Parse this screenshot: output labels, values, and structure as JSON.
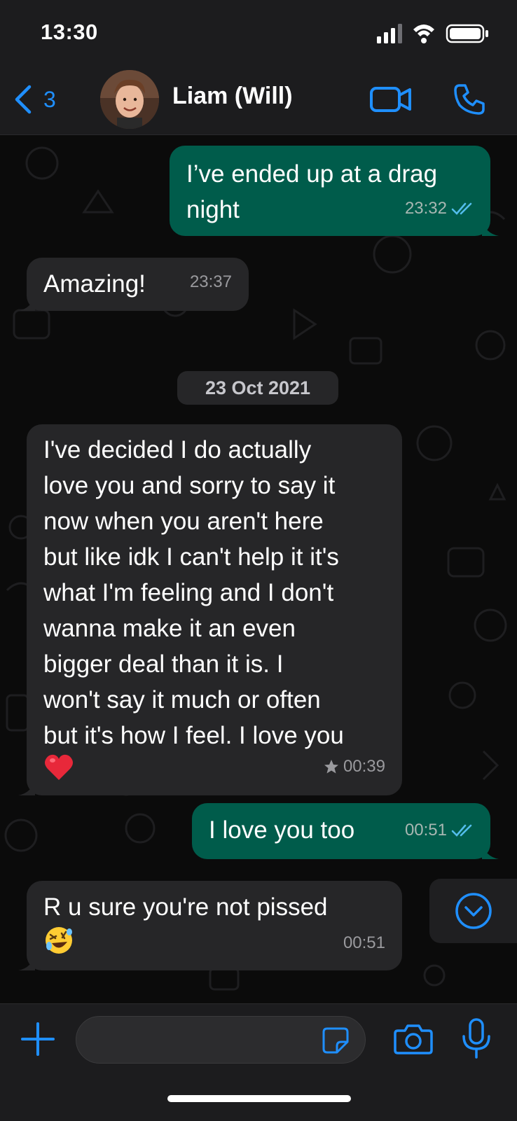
{
  "status_bar": {
    "time": "13:30"
  },
  "header": {
    "back_count": "3",
    "contact_name": "Liam (Will)"
  },
  "messages": [
    {
      "direction": "out",
      "lines": [
        "I’ve ended up at a drag",
        "night"
      ],
      "time": "23:32",
      "status": "read"
    },
    {
      "direction": "in",
      "lines": [
        "Amazing!"
      ],
      "time": "23:37"
    },
    {
      "direction": "in",
      "lines": [
        "I've decided I do actually",
        "love you and sorry to say it",
        "now when you aren't here",
        "but like idk I can't help it it's",
        "what I'm feeling and I don't",
        "wanna make it an even",
        "bigger deal than it is. I",
        "won't say it much or often",
        "but it's how I feel. I love you",
        "❤️"
      ],
      "time": "00:39",
      "starred": true
    },
    {
      "direction": "out",
      "lines": [
        "I love you too"
      ],
      "time": "00:51",
      "status": "read"
    },
    {
      "direction": "in",
      "lines": [
        "R u sure you're not pissed",
        "🤣"
      ],
      "time": "00:51"
    }
  ],
  "date_separator": "23 Oct 2021",
  "composer": {
    "placeholder": ""
  },
  "colors": {
    "accent": "#1f8fff",
    "outgoing_bubble": "#005c4b",
    "incoming_bubble": "#262628",
    "read_ticks": "#53bdeb"
  },
  "icons": {
    "back": "chevron-left-icon",
    "video": "video-camera-icon",
    "call": "phone-icon",
    "scroll_down": "chevron-down-circle-icon",
    "add": "plus-icon",
    "sticker": "sticker-icon",
    "camera": "camera-icon",
    "microphone": "microphone-icon"
  }
}
